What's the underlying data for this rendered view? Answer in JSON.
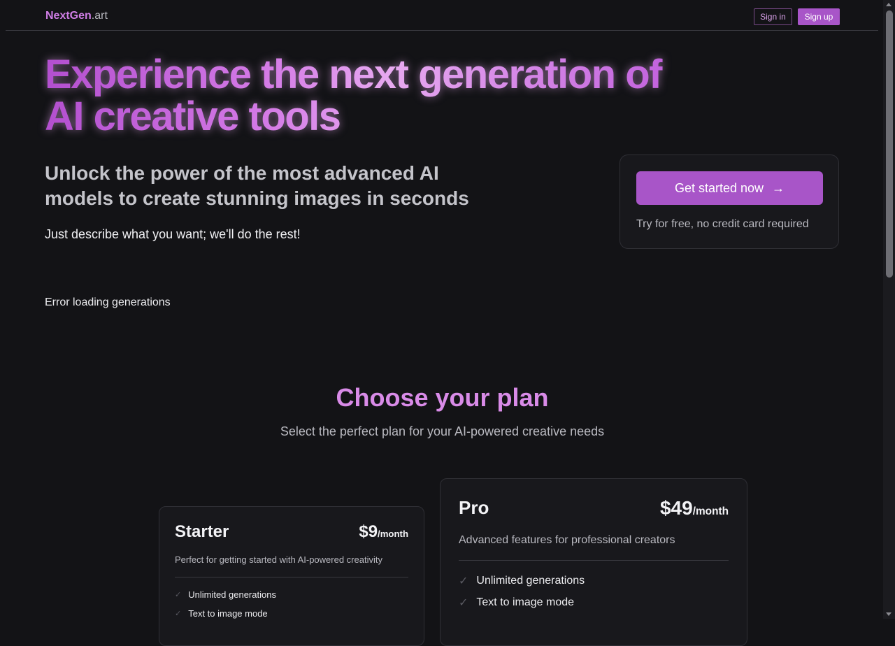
{
  "header": {
    "logo_brand": "NextGen",
    "logo_tld": ".art",
    "signin_label": "Sign in",
    "signup_label": "Sign up"
  },
  "hero": {
    "title": "Experience the next generation of AI creative tools",
    "subtitle": "Unlock the power of the most advanced AI models to create stunning images in seconds",
    "description": "Just describe what you want; we'll do the rest!",
    "cta_label": "Get started now",
    "cta_arrow": "→",
    "cta_note": "Try for free, no credit card required",
    "error_text": "Error loading generations"
  },
  "pricing": {
    "title": "Choose your plan",
    "subtitle": "Select the perfect plan for your AI-powered creative needs",
    "plans": [
      {
        "name": "Starter",
        "price": "$9",
        "period": "/month",
        "description": "Perfect for getting started with AI-powered creativity",
        "features": [
          "Unlimited generations",
          "Text to image mode"
        ]
      },
      {
        "name": "Pro",
        "price": "$49",
        "period": "/month",
        "description": "Advanced features for professional creators",
        "features": [
          "Unlimited generations",
          "Text to image mode"
        ]
      }
    ]
  },
  "icons": {
    "check": "check-icon",
    "arrow": "arrow-right-icon"
  },
  "colors": {
    "accent": "#a855c8",
    "heading_pink": "#d98be8",
    "background": "#131316"
  }
}
